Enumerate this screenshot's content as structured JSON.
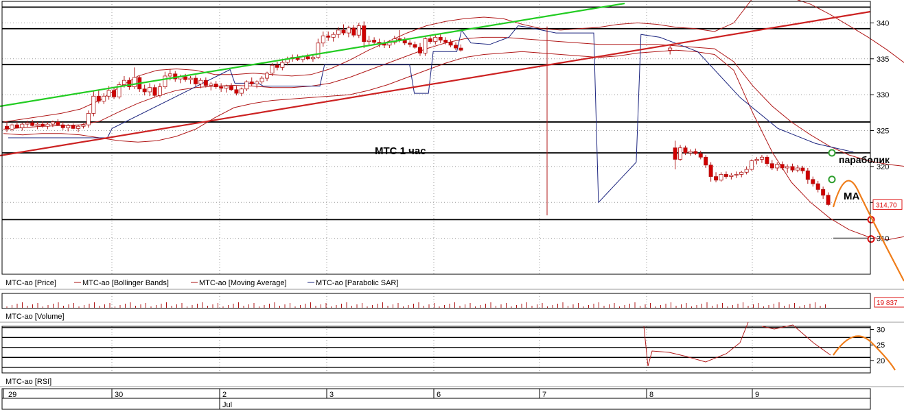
{
  "chart_data": {
    "type": "candlestick",
    "annotation": "МТС   1 час",
    "label_parabolic": "параболик",
    "label_ma": "МА",
    "price_panel": {
      "ylim": [
        305,
        343
      ],
      "yticks": [
        310,
        315,
        320,
        325,
        330,
        335,
        340
      ],
      "ytick_labels": [
        "310",
        "",
        "320",
        "325",
        "330",
        "335",
        "340"
      ],
      "last_price_label": "314,70",
      "legend": [
        {
          "name": "МТС-ао [Price]",
          "color": "#cc0000"
        },
        {
          "name": "МТС-ао [Bollinger Bands]",
          "color": "#aa1111"
        },
        {
          "name": "МТС-ао [Moving Average]",
          "color": "#aa1111"
        },
        {
          "name": "МТС-ао [Parabolic SAR]",
          "color": "#1a237e"
        }
      ],
      "horizontal_levels": [
        342.2,
        339.2,
        334.2,
        326.2,
        321.9,
        312.6
      ],
      "trendlines": [
        {
          "color": "#22cc22",
          "from": [
            0,
            329.2
          ],
          "to": [
            113,
            342.8
          ]
        },
        {
          "color": "#cc2222",
          "from": [
            0,
            323.4
          ],
          "to": [
            157,
            341.4
          ]
        }
      ],
      "candles_ohlc": [
        [
          325.6,
          326.3,
          324.8,
          325.2
        ],
        [
          325.2,
          326.0,
          324.9,
          325.8
        ],
        [
          325.8,
          326.2,
          325.3,
          325.4
        ],
        [
          325.4,
          326.1,
          325.0,
          325.9
        ],
        [
          325.9,
          326.4,
          325.5,
          326.1
        ],
        [
          326.1,
          326.5,
          325.6,
          325.7
        ],
        [
          325.7,
          326.2,
          325.2,
          325.9
        ],
        [
          325.9,
          326.3,
          325.4,
          325.6
        ],
        [
          325.6,
          326.2,
          325.2,
          325.9
        ],
        [
          325.9,
          326.4,
          325.5,
          326.2
        ],
        [
          326.2,
          326.6,
          325.7,
          325.8
        ],
        [
          325.8,
          326.2,
          325.1,
          325.4
        ],
        [
          325.4,
          325.9,
          324.9,
          325.7
        ],
        [
          325.7,
          326.0,
          325.2,
          325.3
        ],
        [
          325.3,
          325.8,
          324.8,
          325.6
        ],
        [
          325.6,
          326.0,
          325.3,
          325.8
        ],
        [
          325.8,
          327.8,
          325.4,
          327.4
        ],
        [
          327.4,
          330.5,
          327.0,
          329.8
        ],
        [
          329.8,
          330.6,
          328.8,
          329.1
        ],
        [
          329.1,
          330.2,
          328.7,
          329.8
        ],
        [
          329.8,
          331.2,
          329.3,
          330.6
        ],
        [
          330.6,
          331.0,
          329.4,
          329.7
        ],
        [
          329.7,
          331.8,
          329.4,
          331.4
        ],
        [
          331.4,
          332.6,
          331.0,
          332.0
        ],
        [
          332.0,
          332.4,
          330.7,
          331.1
        ],
        [
          331.1,
          333.8,
          330.8,
          332.4
        ],
        [
          332.4,
          332.6,
          330.4,
          330.8
        ],
        [
          330.8,
          331.4,
          329.9,
          330.4
        ],
        [
          330.4,
          331.6,
          329.8,
          331.0
        ],
        [
          331.0,
          331.4,
          329.6,
          329.9
        ],
        [
          329.9,
          331.6,
          329.6,
          331.1
        ],
        [
          331.1,
          333.2,
          330.8,
          332.6
        ],
        [
          332.6,
          333.6,
          332.0,
          332.9
        ],
        [
          332.9,
          333.3,
          331.8,
          332.2
        ],
        [
          332.2,
          332.8,
          331.6,
          332.5
        ],
        [
          332.5,
          332.9,
          331.8,
          332.1
        ],
        [
          332.1,
          332.6,
          331.5,
          332.3
        ],
        [
          332.3,
          332.7,
          331.2,
          331.5
        ],
        [
          331.5,
          332.3,
          330.9,
          332.0
        ],
        [
          332.0,
          332.4,
          331.0,
          331.3
        ],
        [
          331.3,
          331.8,
          330.6,
          331.5
        ],
        [
          331.5,
          331.9,
          330.8,
          331.1
        ],
        [
          331.1,
          331.6,
          330.4,
          330.9
        ],
        [
          330.9,
          331.4,
          330.3,
          331.2
        ],
        [
          331.2,
          331.6,
          330.5,
          330.7
        ],
        [
          330.7,
          331.2,
          329.9,
          330.2
        ],
        [
          330.2,
          331.0,
          329.8,
          330.8
        ],
        [
          330.8,
          332.0,
          330.5,
          331.8
        ],
        [
          331.8,
          332.4,
          331.2,
          331.5
        ],
        [
          331.5,
          332.0,
          330.9,
          331.8
        ],
        [
          331.8,
          332.6,
          331.5,
          332.3
        ],
        [
          332.3,
          333.2,
          331.9,
          333.0
        ],
        [
          333.0,
          334.4,
          332.6,
          334.1
        ],
        [
          334.1,
          334.6,
          333.4,
          333.8
        ],
        [
          333.8,
          334.8,
          333.4,
          334.5
        ],
        [
          334.5,
          335.3,
          334.1,
          335.0
        ],
        [
          335.0,
          335.6,
          334.6,
          335.2
        ],
        [
          335.2,
          335.6,
          334.7,
          334.9
        ],
        [
          334.9,
          335.5,
          334.5,
          335.3
        ],
        [
          335.3,
          335.7,
          334.8,
          335.0
        ],
        [
          335.0,
          335.5,
          334.6,
          335.2
        ],
        [
          335.2,
          337.8,
          335.0,
          337.2
        ],
        [
          337.2,
          338.8,
          336.7,
          338.2
        ],
        [
          338.2,
          338.8,
          337.5,
          338.0
        ],
        [
          338.0,
          338.7,
          337.4,
          338.4
        ],
        [
          338.4,
          339.4,
          337.9,
          339.0
        ],
        [
          339.0,
          339.8,
          338.3,
          338.6
        ],
        [
          338.6,
          339.6,
          338.0,
          339.3
        ],
        [
          339.3,
          339.7,
          338.0,
          338.3
        ],
        [
          338.3,
          340.0,
          337.9,
          339.6
        ],
        [
          339.6,
          340.2,
          336.5,
          337.4
        ],
        [
          337.4,
          338.2,
          336.8,
          337.6
        ],
        [
          337.6,
          338.0,
          337.0,
          337.3
        ],
        [
          337.3,
          337.8,
          336.6,
          337.1
        ],
        [
          337.1,
          337.6,
          336.5,
          336.9
        ],
        [
          336.9,
          337.6,
          336.5,
          337.3
        ],
        [
          337.3,
          338.2,
          337.0,
          337.8
        ],
        [
          337.8,
          339.0,
          337.3,
          337.6
        ],
        [
          337.6,
          338.0,
          336.9,
          337.2
        ],
        [
          337.2,
          337.6,
          336.6,
          337.0
        ],
        [
          337.0,
          337.4,
          336.4,
          336.6
        ],
        [
          336.6,
          337.2,
          335.4,
          335.8
        ],
        [
          335.8,
          338.0,
          335.4,
          337.8
        ],
        [
          337.8,
          338.2,
          337.1,
          337.4
        ],
        [
          337.4,
          338.4,
          337.0,
          338.0
        ],
        [
          338.0,
          338.4,
          337.2,
          337.6
        ],
        [
          337.6,
          338.0,
          337.0,
          337.3
        ],
        [
          337.3,
          337.7,
          336.6,
          336.9
        ],
        [
          336.9,
          337.3,
          336.2,
          336.5
        ],
        [
          336.5,
          337.0,
          336.0,
          336.2
        ],
        [
          336.2,
          336.8,
          335.6,
          336.5
        ],
        [
          322.6,
          323.6,
          319.6,
          321.0
        ],
        [
          321.0,
          323.0,
          320.8,
          322.6
        ],
        [
          322.6,
          322.9,
          321.6,
          321.9
        ],
        [
          321.9,
          322.4,
          321.5,
          322.1
        ],
        [
          322.1,
          322.5,
          321.6,
          321.8
        ],
        [
          321.8,
          322.2,
          321.0,
          321.3
        ],
        [
          321.3,
          321.6,
          319.8,
          320.2
        ],
        [
          320.2,
          320.6,
          317.9,
          318.6
        ],
        [
          318.6,
          319.2,
          317.8,
          318.1
        ],
        [
          318.1,
          319.2,
          317.9,
          318.9
        ],
        [
          318.9,
          319.3,
          318.3,
          318.6
        ],
        [
          318.6,
          319.1,
          318.2,
          318.8
        ],
        [
          318.8,
          319.3,
          318.4,
          318.9
        ],
        [
          318.9,
          319.4,
          318.5,
          319.2
        ],
        [
          319.2,
          320.0,
          318.9,
          319.6
        ],
        [
          319.6,
          321.0,
          319.4,
          320.8
        ],
        [
          320.8,
          321.3,
          320.3,
          321.0
        ],
        [
          321.0,
          321.6,
          320.5,
          321.3
        ],
        [
          321.3,
          321.6,
          320.0,
          320.4
        ],
        [
          320.4,
          320.9,
          319.5,
          319.8
        ],
        [
          319.8,
          320.6,
          319.4,
          320.3
        ],
        [
          320.3,
          320.7,
          319.5,
          319.8
        ],
        [
          319.8,
          320.3,
          319.1,
          320.0
        ],
        [
          320.0,
          320.4,
          319.2,
          319.5
        ],
        [
          319.5,
          320.2,
          319.2,
          319.8
        ],
        [
          319.8,
          320.1,
          319.0,
          319.4
        ],
        [
          319.4,
          319.8,
          317.6,
          318.2
        ],
        [
          318.2,
          318.6,
          317.2,
          317.6
        ],
        [
          317.6,
          318.0,
          316.4,
          316.8
        ],
        [
          316.8,
          317.2,
          315.5,
          316.0
        ],
        [
          316.0,
          316.4,
          314.5,
          314.7
        ]
      ],
      "bollinger_upper": [
        326.2,
        326.6,
        327.0,
        327.4,
        328.0,
        329.2,
        331.0,
        332.6,
        333.4,
        333.6,
        333.4,
        332.8,
        332.8,
        333.0,
        332.8,
        332.6,
        332.8,
        333.6,
        334.8,
        336.2,
        337.4,
        338.6,
        339.6,
        340.2,
        340.6,
        340.8,
        340.6,
        339.8,
        339.2,
        339.0,
        339.2,
        339.4,
        339.8,
        340.0,
        339.8,
        339.4,
        339.2,
        338.8,
        340.0,
        343.5,
        343.8,
        343.5,
        342.6,
        341.2,
        339.6,
        338.0,
        336.2,
        334.2,
        331.8,
        328.8,
        325.8,
        322.6,
        322.2,
        322.0,
        321.6
      ],
      "bollinger_lower": [
        324.6,
        324.4,
        324.6,
        324.6,
        324.4,
        324.0,
        323.6,
        323.4,
        323.6,
        324.2,
        325.2,
        326.8,
        328.2,
        328.8,
        329.2,
        329.4,
        329.6,
        329.8,
        330.0,
        330.6,
        331.4,
        332.4,
        333.4,
        334.4,
        335.2,
        335.6,
        335.8,
        336.0,
        335.8,
        335.6,
        335.4,
        335.2,
        335.4,
        335.8,
        336.0,
        336.2,
        336.0,
        335.6,
        333.4,
        327.4,
        322.0,
        317.8,
        315.0,
        312.8,
        311.2,
        310.2,
        309.8,
        310.3,
        311.2,
        312.5,
        314.2,
        316.0,
        317.0,
        317.2,
        317.0
      ],
      "moving_average": [
        325.2,
        325.4,
        325.6,
        325.7,
        325.8,
        326.3,
        327.6,
        328.8,
        329.8,
        330.6,
        331.0,
        331.2,
        331.3,
        331.2,
        331.0,
        331.0,
        331.2,
        331.6,
        332.4,
        333.4,
        334.4,
        335.4,
        336.4,
        337.2,
        337.8,
        338.0,
        338.0,
        337.8,
        337.6,
        337.4,
        337.2,
        337.0,
        337.0,
        337.0,
        337.0,
        336.8,
        336.6,
        336.4,
        334.6,
        331.2,
        328.4,
        326.2,
        324.4,
        322.8,
        321.6,
        320.8,
        320.3,
        320.0,
        320.0,
        320.1,
        320.2,
        320.2,
        319.8,
        319.2,
        318.4
      ],
      "parabolic_sar": [
        [
          1,
          324.0
        ],
        [
          22,
          324.0
        ],
        [
          23,
          325.3
        ],
        [
          48,
          333.5
        ],
        [
          49,
          331.6
        ],
        [
          54,
          331.6
        ],
        [
          55,
          331.2
        ],
        [
          67,
          331.2
        ],
        [
          68,
          334.2
        ],
        [
          86,
          334.2
        ],
        [
          87,
          330.2
        ],
        [
          90,
          330.2
        ],
        [
          91,
          336.0
        ],
        [
          96,
          336.0
        ],
        [
          97,
          339.0
        ],
        [
          99,
          337.2
        ],
        [
          103,
          337.0
        ],
        [
          107,
          338.0
        ],
        [
          109,
          339.6
        ],
        [
          111,
          339.4
        ],
        [
          117,
          338.6
        ],
        [
          125,
          338.6
        ],
        [
          126,
          315.0
        ],
        [
          134,
          320.6
        ],
        [
          135,
          338.4
        ],
        [
          139,
          338.0
        ],
        [
          143,
          337.0
        ],
        [
          147,
          336.0
        ],
        [
          156,
          329.6
        ],
        [
          164,
          325.3
        ],
        [
          172,
          323.2
        ],
        [
          180,
          322.0
        ]
      ],
      "sar_dots": [
        {
          "i": 180,
          "v": 321.9,
          "color": "#2e9e2e"
        },
        {
          "i": 180,
          "v": 318.2,
          "color": "#2e9e2e"
        },
        {
          "i": 189,
          "v": 312.6,
          "color": "#d11"
        },
        {
          "i": 189,
          "v": 309.9,
          "color": "#d11"
        }
      ]
    },
    "volume_panel": {
      "legend": "МТС-ао [Volume]",
      "last_label": "19 837"
    },
    "rsi_panel": {
      "legend": "МТС-ао [RSI]",
      "yticks": [
        20,
        25,
        30
      ],
      "ytick_labels": [
        "20",
        "25",
        "30"
      ],
      "ylim": [
        16,
        31
      ]
    },
    "x_axis": {
      "day_labels": [
        "29",
        "30",
        "2",
        "3",
        "6",
        "7",
        "8",
        "9"
      ],
      "month_label": "Jul"
    }
  }
}
